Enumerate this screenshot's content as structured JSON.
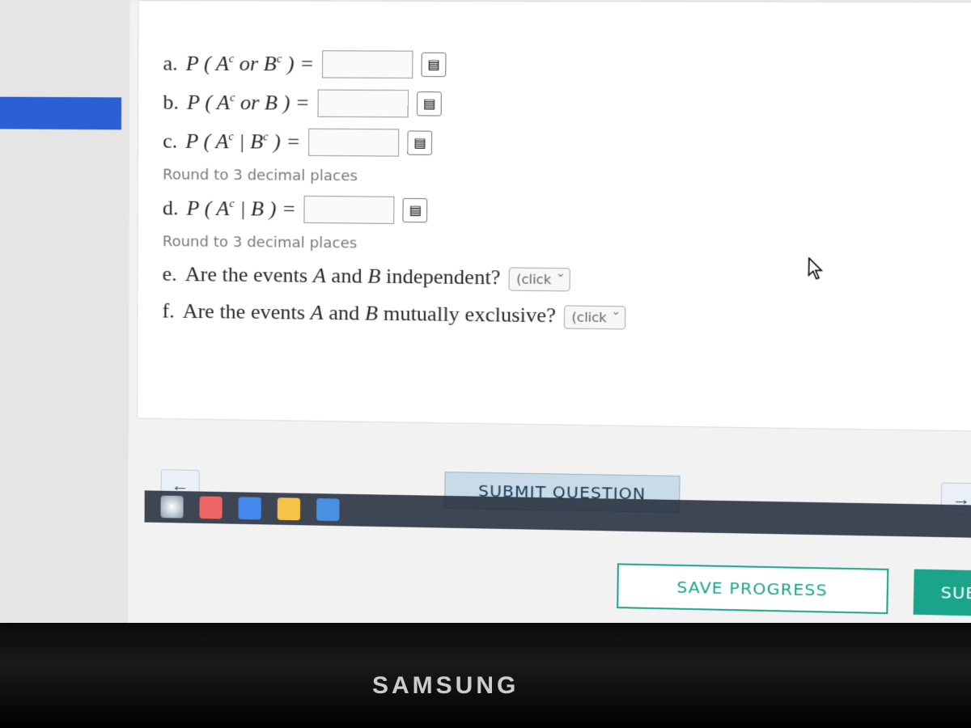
{
  "left": {
    "paren": ")"
  },
  "questions": {
    "a": {
      "label": "a.",
      "expr_prefix": "P ( A",
      "sup": "c",
      "mid": " or B",
      "sup2": "c",
      "expr_suffix": " ) ="
    },
    "b": {
      "label": "b.",
      "expr_prefix": "P ( A",
      "sup": "c",
      "mid": " or B",
      "expr_suffix": " ) ="
    },
    "c": {
      "label": "c.",
      "expr_prefix": "P ( A",
      "sup": "c",
      "mid": " | B",
      "sup2": "c",
      "expr_suffix": " ) =",
      "hint": "Round to 3 decimal places"
    },
    "d": {
      "label": "d.",
      "expr_prefix": "P ( A",
      "sup": "c",
      "mid": " | B",
      "expr_suffix": " ) =",
      "hint": "Round to 3 decimal places"
    },
    "e": {
      "label": "e.",
      "text": "Are the events A and B independent?",
      "placeholder": "(click"
    },
    "f": {
      "label": "f.",
      "text": "Are the events A and B mutually exclusive?",
      "placeholder": "(click"
    }
  },
  "buttons": {
    "back": "←",
    "submit_question": "SUBMIT QUESTION",
    "next": "→",
    "save_progress": "SAVE PROGRESS",
    "submit": "SUB"
  },
  "monitor_brand": "SAMSUNG"
}
